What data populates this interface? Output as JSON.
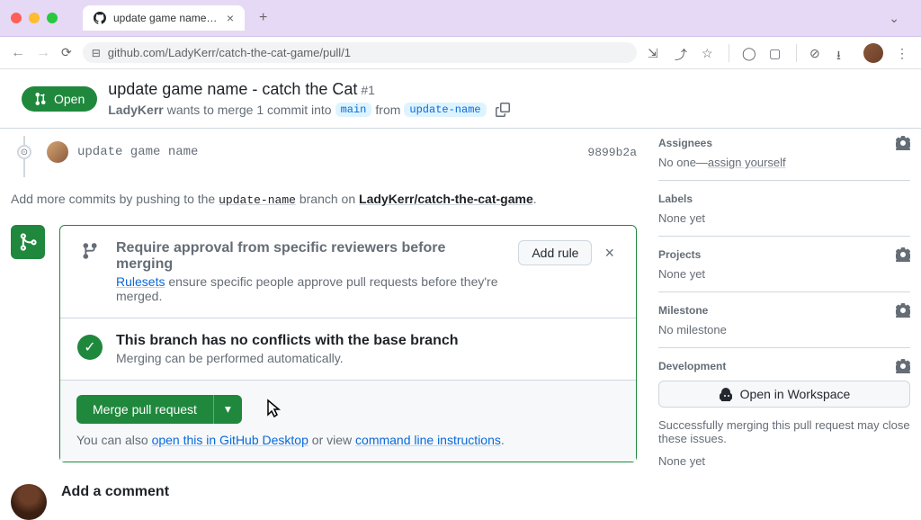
{
  "browser": {
    "tab_title": "update game name - catch th",
    "url": "github.com/LadyKerr/catch-the-cat-game/pull/1"
  },
  "header": {
    "state": "Open",
    "title": "update game name - catch the Cat",
    "number": "#1",
    "author": "LadyKerr",
    "action_text": "wants to merge 1 commit into",
    "base_branch": "main",
    "from_text": "from",
    "head_branch": "update-name"
  },
  "commit": {
    "message": "update game name",
    "sha": "9899b2a"
  },
  "push_hint": {
    "prefix": "Add more commits by pushing to the",
    "branch": "update-name",
    "middle": "branch on",
    "repo": "LadyKerr/catch-the-cat-game",
    "suffix": "."
  },
  "ruleset_box": {
    "title": "Require approval from specific reviewers before merging",
    "link": "Rulesets",
    "desc": "ensure specific people approve pull requests before they're merged.",
    "add_rule": "Add rule"
  },
  "conflicts_box": {
    "title": "This branch has no conflicts with the base branch",
    "desc": "Merging can be performed automatically."
  },
  "merge": {
    "button": "Merge pull request",
    "hint_prefix": "You can also",
    "desktop_link": "open this in GitHub Desktop",
    "hint_or": "or view",
    "cli_link": "command line instructions",
    "hint_suffix": "."
  },
  "comment": {
    "title": "Add a comment"
  },
  "sidebar": {
    "assignees": {
      "label": "Assignees",
      "value_prefix": "No one—",
      "link": "assign yourself"
    },
    "labels": {
      "label": "Labels",
      "value": "None yet"
    },
    "projects": {
      "label": "Projects",
      "value": "None yet"
    },
    "milestone": {
      "label": "Milestone",
      "value": "No milestone"
    },
    "development": {
      "label": "Development",
      "button": "Open in Workspace",
      "desc": "Successfully merging this pull request may close these issues.",
      "value": "None yet"
    }
  }
}
